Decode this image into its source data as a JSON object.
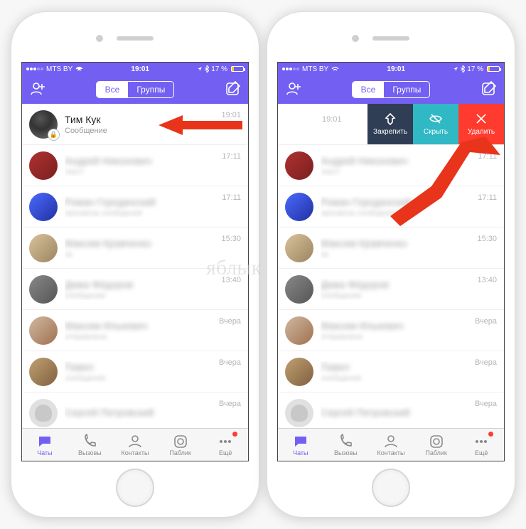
{
  "status": {
    "carrier": "MTS BY",
    "clock": "19:01",
    "battery_pct": "17 %"
  },
  "nav": {
    "segment_all": "Все",
    "segment_groups": "Группы"
  },
  "chats": [
    {
      "name": "Тим Кук",
      "sub": "Сообщение",
      "time": "19:01"
    },
    {
      "name": "Андрей Никонович",
      "sub": "текст",
      "time": "17:11"
    },
    {
      "name": "Роман Городинский",
      "sub": "просмотр сообщения",
      "time": "17:11"
    },
    {
      "name": "Максим Кравченко",
      "sub": "ок",
      "time": "15:30"
    },
    {
      "name": "Дима Фёдоров",
      "sub": "сообщение",
      "time": "13:40"
    },
    {
      "name": "Максим Илькевич",
      "sub": "отправлено",
      "time": "Вчера"
    },
    {
      "name": "Павел",
      "sub": "сообщение",
      "time": "Вчера"
    },
    {
      "name": "Сергей Петровский",
      "sub": "",
      "time": "Вчера"
    }
  ],
  "swipe": {
    "pin": "Закрепить",
    "hide": "Скрыть",
    "delete": "Удалить"
  },
  "tabs": {
    "chats": "Чаты",
    "calls": "Вызовы",
    "contacts": "Контакты",
    "public": "Паблик",
    "more": "Ещё"
  },
  "watermark": "яблык"
}
